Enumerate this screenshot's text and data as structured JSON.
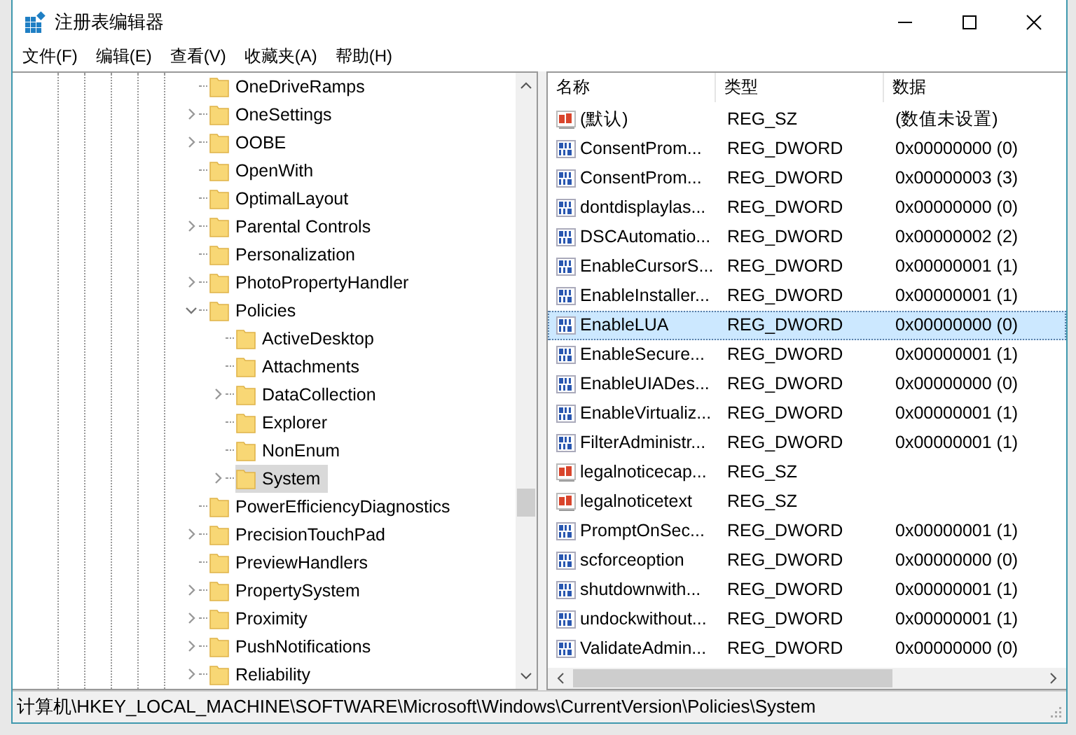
{
  "window": {
    "title": "注册表编辑器"
  },
  "menu": [
    "文件(F)",
    "编辑(E)",
    "查看(V)",
    "收藏夹(A)",
    "帮助(H)"
  ],
  "tree": [
    {
      "label": "OneDriveRamps",
      "selected": false
    },
    {
      "label": "OneSettings",
      "expanded": false,
      "selected": false
    },
    {
      "label": "OOBE",
      "expanded": false,
      "selected": false
    },
    {
      "label": "OpenWith",
      "selected": false
    },
    {
      "label": "OptimalLayout",
      "selected": false
    },
    {
      "label": "Parental Controls",
      "expanded": false,
      "selected": false
    },
    {
      "label": "Personalization",
      "selected": false
    },
    {
      "label": "PhotoPropertyHandler",
      "expanded": false,
      "selected": false
    },
    {
      "label": "Policies",
      "expanded": true,
      "selected": false,
      "children": [
        {
          "label": "ActiveDesktop",
          "selected": false
        },
        {
          "label": "Attachments",
          "selected": false
        },
        {
          "label": "DataCollection",
          "expanded": false,
          "selected": false
        },
        {
          "label": "Explorer",
          "selected": false
        },
        {
          "label": "NonEnum",
          "selected": false
        },
        {
          "label": "System",
          "expanded": false,
          "selected": true
        }
      ]
    },
    {
      "label": "PowerEfficiencyDiagnostics",
      "selected": false
    },
    {
      "label": "PrecisionTouchPad",
      "expanded": false,
      "selected": false
    },
    {
      "label": "PreviewHandlers",
      "selected": false
    },
    {
      "label": "PropertySystem",
      "expanded": false,
      "selected": false
    },
    {
      "label": "Proximity",
      "expanded": false,
      "selected": false
    },
    {
      "label": "PushNotifications",
      "expanded": false,
      "selected": false
    },
    {
      "label": "Reliability",
      "expanded": false,
      "selected": false
    }
  ],
  "table": {
    "columns": [
      "名称",
      "类型",
      "数据"
    ],
    "rows": [
      {
        "kind": "string",
        "name": "(默认)",
        "type": "REG_SZ",
        "data": "(数值未设置)",
        "selected": false
      },
      {
        "kind": "binary",
        "name": "ConsentProm...",
        "type": "REG_DWORD",
        "data": "0x00000000 (0)",
        "selected": false
      },
      {
        "kind": "binary",
        "name": "ConsentProm...",
        "type": "REG_DWORD",
        "data": "0x00000003 (3)",
        "selected": false
      },
      {
        "kind": "binary",
        "name": "dontdisplaylas...",
        "type": "REG_DWORD",
        "data": "0x00000000 (0)",
        "selected": false
      },
      {
        "kind": "binary",
        "name": "DSCAutomatio...",
        "type": "REG_DWORD",
        "data": "0x00000002 (2)",
        "selected": false
      },
      {
        "kind": "binary",
        "name": "EnableCursorS...",
        "type": "REG_DWORD",
        "data": "0x00000001 (1)",
        "selected": false
      },
      {
        "kind": "binary",
        "name": "EnableInstaller...",
        "type": "REG_DWORD",
        "data": "0x00000001 (1)",
        "selected": false
      },
      {
        "kind": "binary",
        "name": "EnableLUA",
        "type": "REG_DWORD",
        "data": "0x00000000 (0)",
        "selected": true
      },
      {
        "kind": "binary",
        "name": "EnableSecure...",
        "type": "REG_DWORD",
        "data": "0x00000001 (1)",
        "selected": false
      },
      {
        "kind": "binary",
        "name": "EnableUIADes...",
        "type": "REG_DWORD",
        "data": "0x00000000 (0)",
        "selected": false
      },
      {
        "kind": "binary",
        "name": "EnableVirtualiz...",
        "type": "REG_DWORD",
        "data": "0x00000001 (1)",
        "selected": false
      },
      {
        "kind": "binary",
        "name": "FilterAdministr...",
        "type": "REG_DWORD",
        "data": "0x00000001 (1)",
        "selected": false
      },
      {
        "kind": "string",
        "name": "legalnoticecap...",
        "type": "REG_SZ",
        "selected": false
      },
      {
        "kind": "string",
        "name": "legalnoticetext",
        "type": "REG_SZ",
        "selected": false
      },
      {
        "kind": "binary",
        "name": "PromptOnSec...",
        "type": "REG_DWORD",
        "data": "0x00000001 (1)",
        "selected": false
      },
      {
        "kind": "binary",
        "name": "scforceoption",
        "type": "REG_DWORD",
        "data": "0x00000000 (0)",
        "selected": false
      },
      {
        "kind": "binary",
        "name": "shutdownwith...",
        "type": "REG_DWORD",
        "data": "0x00000001 (1)",
        "selected": false
      },
      {
        "kind": "binary",
        "name": "undockwithout...",
        "type": "REG_DWORD",
        "data": "0x00000001 (1)",
        "selected": false
      },
      {
        "kind": "binary",
        "name": "ValidateAdmin...",
        "type": "REG_DWORD",
        "data": "0x00000000 (0)",
        "selected": false
      }
    ]
  },
  "status_bar": "计算机\\HKEY_LOCAL_MACHINE\\SOFTWARE\\Microsoft\\Windows\\CurrentVersion\\Policies\\System"
}
